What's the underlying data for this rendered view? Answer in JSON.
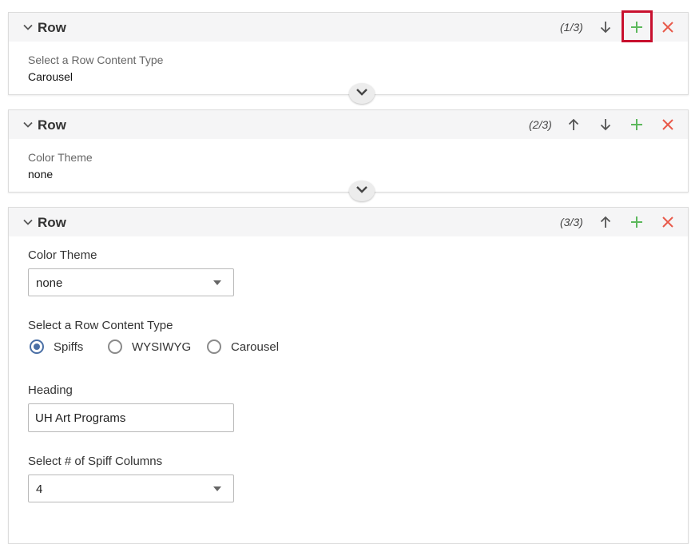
{
  "rows": [
    {
      "title": "Row",
      "counter": "(1/3)",
      "summary_label": "Select a Row Content Type",
      "summary_value": "Carousel"
    },
    {
      "title": "Row",
      "counter": "(2/3)",
      "summary_label": "Color Theme",
      "summary_value": "none"
    },
    {
      "title": "Row",
      "counter": "(3/3)",
      "color_theme": {
        "label": "Color Theme",
        "value": "none"
      },
      "content_type": {
        "label": "Select a Row Content Type",
        "options": [
          "Spiffs",
          "WYSIWYG",
          "Carousel"
        ],
        "selected": "Spiffs"
      },
      "heading": {
        "label": "Heading",
        "value": "UH Art Programs"
      },
      "spiff_columns": {
        "label": "Select # of Spiff Columns",
        "value": "4"
      }
    }
  ],
  "colors": {
    "add": "#5cb85c",
    "remove": "#e8594a",
    "highlight": "#c8102e",
    "radio_checked": "#4a6fa5"
  }
}
